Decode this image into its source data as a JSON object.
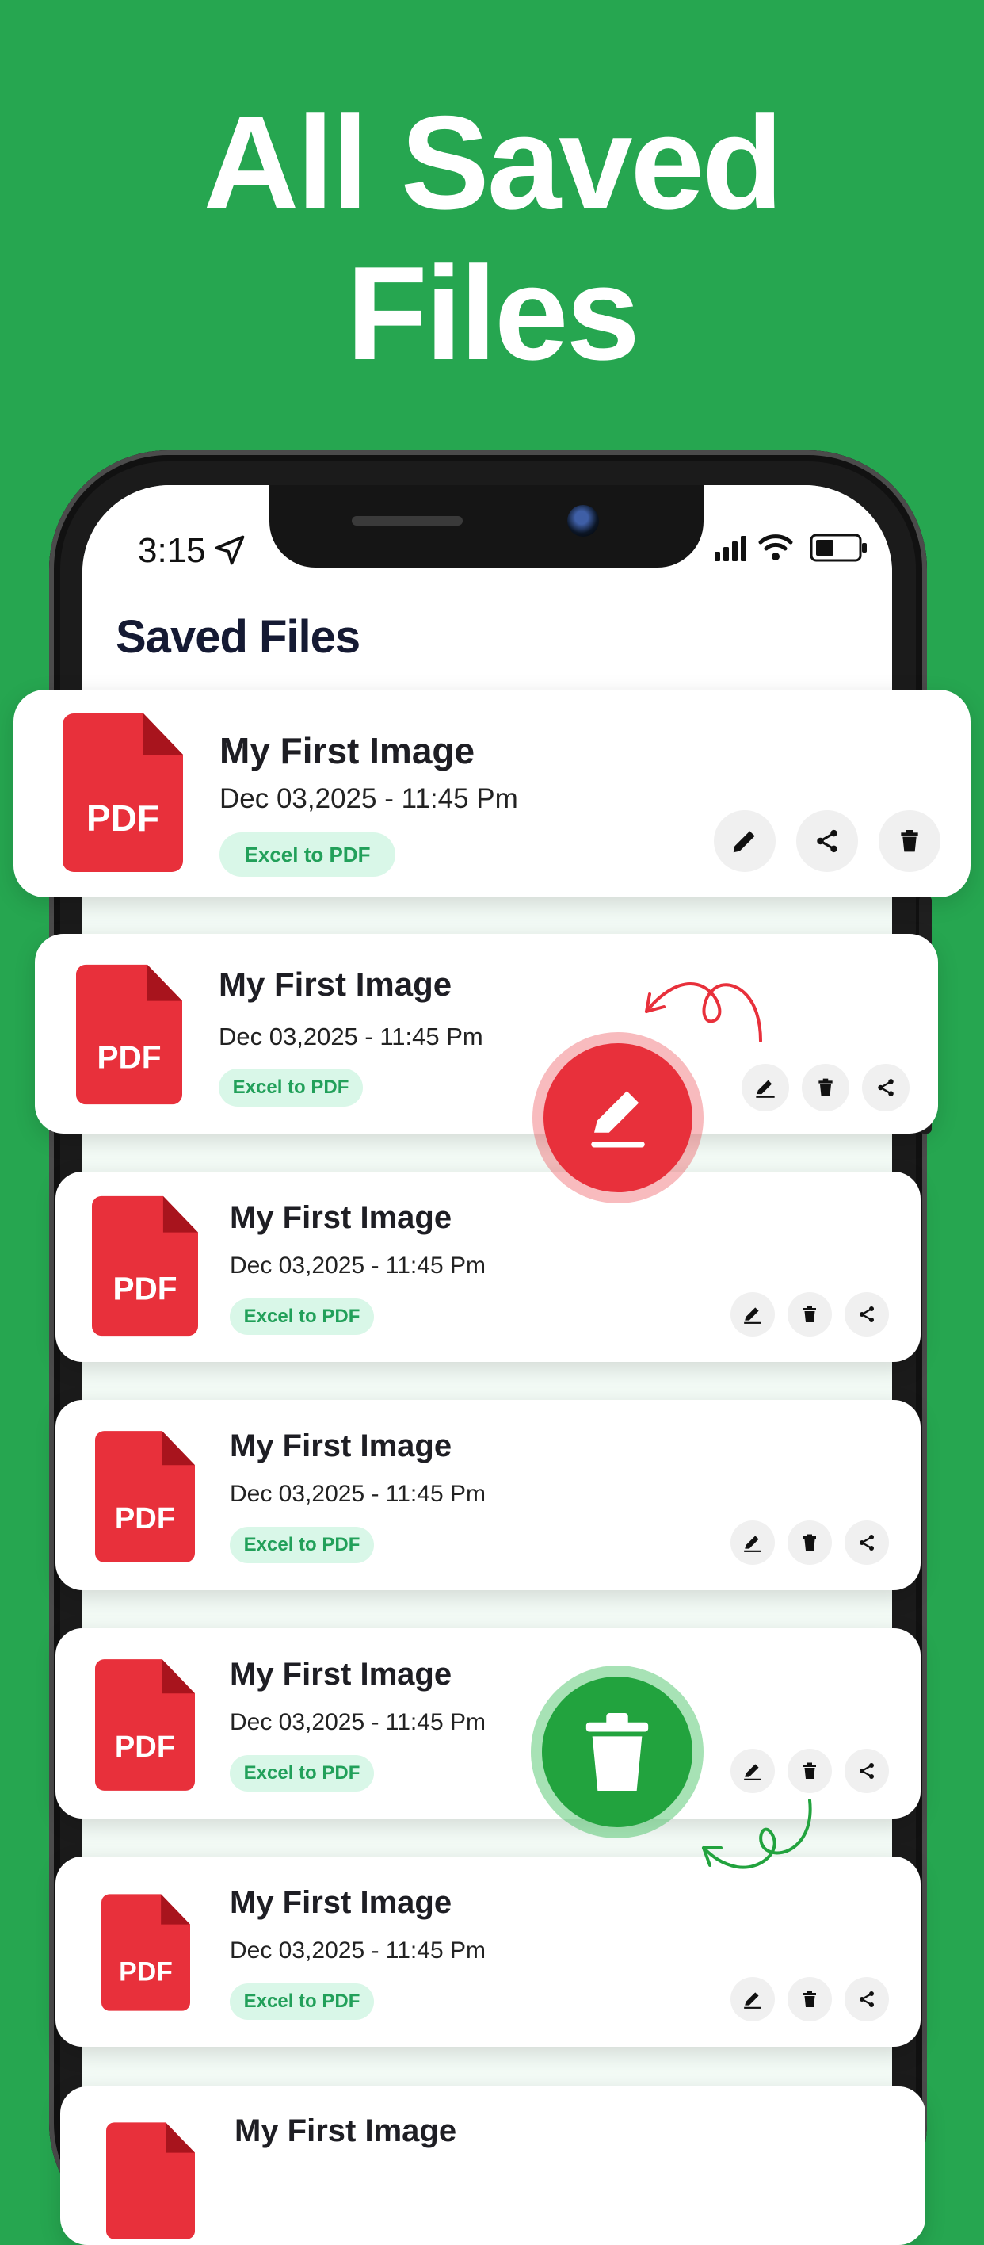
{
  "headline": {
    "line1": "All Saved",
    "line2": "Files"
  },
  "status_bar": {
    "time": "3:15"
  },
  "screen": {
    "title": "Saved Files"
  },
  "files": [
    {
      "title": "My First Image",
      "date": "Dec 03,2025 - 11:45 Pm",
      "badge": "Excel to PDF",
      "icon_label": "PDF"
    },
    {
      "title": "My First Image",
      "date": "Dec 03,2025 - 11:45 Pm",
      "badge": "Excel to PDF",
      "icon_label": "PDF"
    },
    {
      "title": "My First Image",
      "date": "Dec 03,2025 - 11:45 Pm",
      "badge": "Excel to PDF",
      "icon_label": "PDF"
    },
    {
      "title": "My First Image",
      "date": "Dec 03,2025 - 11:45 Pm",
      "badge": "Excel to PDF",
      "icon_label": "PDF"
    },
    {
      "title": "My First Image",
      "date": "Dec 03,2025 - 11:45 Pm",
      "badge": "Excel to PDF",
      "icon_label": "PDF"
    },
    {
      "title": "My First Image",
      "date": "Dec 03,2025 - 11:45 Pm",
      "badge": "Excel to PDF",
      "icon_label": "PDF"
    },
    {
      "title": "My First Image",
      "date": "",
      "badge": "",
      "icon_label": ""
    }
  ],
  "colors": {
    "background": "#26a650",
    "pdf_red": "#e8303b",
    "badge_bg": "#d9f7e8",
    "badge_text": "#22a05a",
    "title_text": "#151a33"
  },
  "icons": [
    "location-arrow-icon",
    "signal-icon",
    "wifi-icon",
    "battery-icon",
    "pencil-icon",
    "share-icon",
    "trash-icon"
  ]
}
